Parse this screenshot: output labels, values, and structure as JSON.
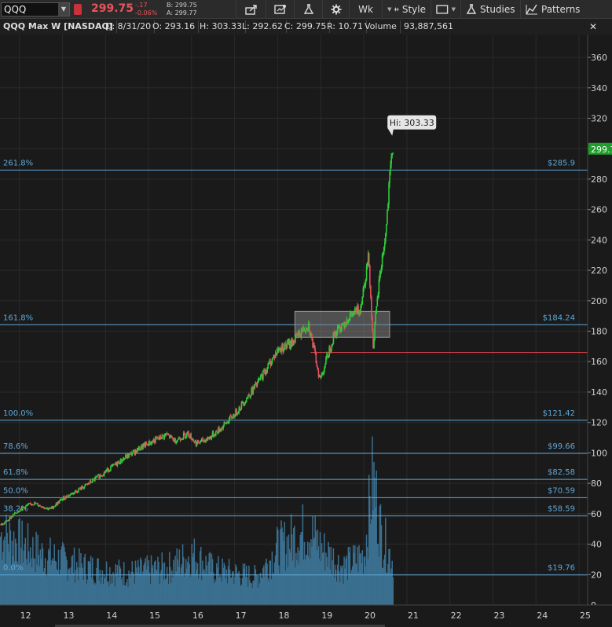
{
  "toolbar": {
    "symbol": "QQQ",
    "last_price": "299.75",
    "change": "-.17",
    "change_pct": "-0.06%",
    "bid": "B: 299.75",
    "ask": "A: 299.77",
    "timeframe_label": "Wk",
    "style_label": "Style",
    "studies_label": "Studies",
    "patterns_label": "Patterns",
    "colors": {
      "down": "#e8535b",
      "toolbar_bg": "#2b2b2b"
    }
  },
  "infobar": {
    "title": "QQQ Max W [NASDAQ]",
    "date": "D: 8/31/20",
    "open": "O: 293.16",
    "high": "H: 303.33",
    "low": "L: 292.62",
    "close": "C: 299.75",
    "range": "R: 10.71",
    "volume_label": "Volume",
    "volume_value": "93,887,561"
  },
  "chart_data": {
    "type": "candlestick",
    "x_ticks": [
      "12",
      "13",
      "14",
      "15",
      "16",
      "17",
      "18",
      "19",
      "20",
      "21",
      "22",
      "23",
      "24",
      "25"
    ],
    "y_ticks": [
      0,
      20,
      40,
      60,
      80,
      100,
      120,
      140,
      160,
      180,
      200,
      220,
      240,
      260,
      280,
      300,
      320,
      340,
      360
    ],
    "ylim": [
      0,
      375
    ],
    "xlim": [
      2011.55,
      2025.2
    ],
    "last_price_tag": "299.7",
    "high_label": "Hi: 303.33",
    "high_value": 303.33,
    "high_year": 2020.66,
    "horizontal_line": 166,
    "zone": {
      "x": [
        2018.4,
        2020.6
      ],
      "y": [
        176,
        193
      ]
    },
    "fib_levels": [
      {
        "label": "261.8%",
        "price_label": "$285.9",
        "value": 285.9
      },
      {
        "label": "161.8%",
        "price_label": "$184.24",
        "value": 184.24
      },
      {
        "label": "100.0%",
        "price_label": "$121.42",
        "value": 121.42
      },
      {
        "label": "78.6%",
        "price_label": "$99.66",
        "value": 99.66
      },
      {
        "label": "61.8%",
        "price_label": "$82.58",
        "value": 82.58
      },
      {
        "label": "50.0%",
        "price_label": "$70.59",
        "value": 70.59
      },
      {
        "label": "38.2%",
        "price_label": "$58.59",
        "value": 58.59
      },
      {
        "label": "0.0%",
        "price_label": "$19.76",
        "value": 19.76
      }
    ],
    "price_series": {
      "years": [
        2011.6,
        2012.0,
        2012.3,
        2012.7,
        2013.0,
        2013.5,
        2014.0,
        2014.5,
        2014.9,
        2015.4,
        2015.6,
        2015.9,
        2016.1,
        2016.4,
        2016.7,
        2017.0,
        2017.5,
        2018.0,
        2018.3,
        2018.7,
        2018.97,
        2019.3,
        2019.6,
        2019.9,
        2020.0,
        2020.1,
        2020.2,
        2020.35,
        2020.5,
        2020.6,
        2020.66
      ],
      "closes": [
        53,
        63,
        67,
        63,
        70,
        78,
        88,
        98,
        105,
        112,
        108,
        113,
        106,
        110,
        117,
        126,
        145,
        168,
        172,
        185,
        148,
        178,
        188,
        195,
        212,
        230,
        170,
        215,
        245,
        285,
        300
      ]
    },
    "volume": {
      "years": [
        2011.6,
        2012.5,
        2013.5,
        2014.5,
        2015.5,
        2016.0,
        2016.5,
        2017.0,
        2017.5,
        2018.0,
        2018.7,
        2019.0,
        2019.5,
        2020.0,
        2020.2,
        2020.4,
        2020.66
      ],
      "levels": [
        55,
        40,
        30,
        25,
        30,
        40,
        28,
        25,
        22,
        45,
        60,
        45,
        30,
        40,
        100,
        55,
        35
      ]
    },
    "colors": {
      "up": "#2fcc3a",
      "down": "#e05260",
      "fib": "#5fa8d9",
      "volume": "#3b6f8f",
      "red_line": "#e0454d",
      "zone": "#7d7d7d"
    }
  }
}
